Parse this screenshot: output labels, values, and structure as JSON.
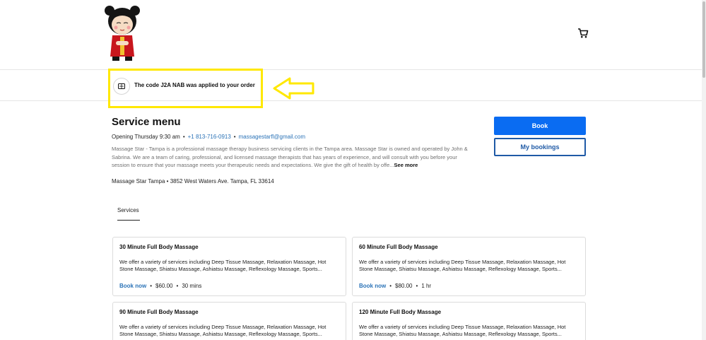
{
  "promo": {
    "text": "The code J2A NAB was applied to your order"
  },
  "business": {
    "title": "Service menu",
    "opening": "Opening Thursday 9:30 am",
    "phone": "+1 813-716-0913",
    "email": "massagestarfl@gmail.com",
    "description": "Massage Star - Tampa is a professional massage therapy business servicing clients in the Tampa area. Massage Star is owned and operated by John & Sabrina. We are a team of caring, professional, and licensed massage therapists that has years of experience, and will consult with you before your session to ensure that your massage meets your therapeutic needs and expectations. We give the gift of health by offe...",
    "see_more": "See more",
    "address": "Massage Star Tampa • 3852 West Waters Ave. Tampa, FL 33614",
    "sep": "•"
  },
  "actions": {
    "book": "Book",
    "my_bookings": "My bookings"
  },
  "tabs": {
    "services": "Services"
  },
  "services": [
    {
      "name": "30 Minute Full Body Massage",
      "description": "We offer a variety of services including Deep Tissue Massage, Relaxation Massage, Hot Stone Massage, Shiatsu Massage, Ashiatsu Massage, Reflexology Massage, Sports...",
      "book": "Book now",
      "price": "$60.00",
      "duration": "30 mins"
    },
    {
      "name": "60 Minute Full Body Massage",
      "description": "We offer a variety of services including Deep Tissue Massage, Relaxation Massage, Hot Stone Massage, Shiatsu Massage, Ashiatsu Massage, Reflexology Massage, Sports...",
      "book": "Book now",
      "price": "$80.00",
      "duration": "1 hr"
    },
    {
      "name": "90 Minute Full Body Massage",
      "description": "We offer a variety of services including Deep Tissue Massage, Relaxation Massage, Hot Stone Massage, Shiatsu Massage, Ashiatsu Massage, Reflexology Massage, Sports...",
      "book": "",
      "price": "",
      "duration": ""
    },
    {
      "name": "120 Minute Full Body Massage",
      "description": "We offer a variety of services including Deep Tissue Massage, Relaxation Massage, Hot Stone Massage, Shiatsu Massage, Ashiatsu Massage, Reflexology Massage, Sports...",
      "book": "",
      "price": "",
      "duration": ""
    }
  ],
  "icons": {
    "logo": "doll-logo-icon",
    "cart": "cart-icon",
    "promo": "ticket-icon",
    "annotation_arrow": "arrow-left-icon"
  },
  "colors": {
    "accent": "#0a6cf2",
    "link": "#2b73b7",
    "highlight": "#ffe800"
  }
}
